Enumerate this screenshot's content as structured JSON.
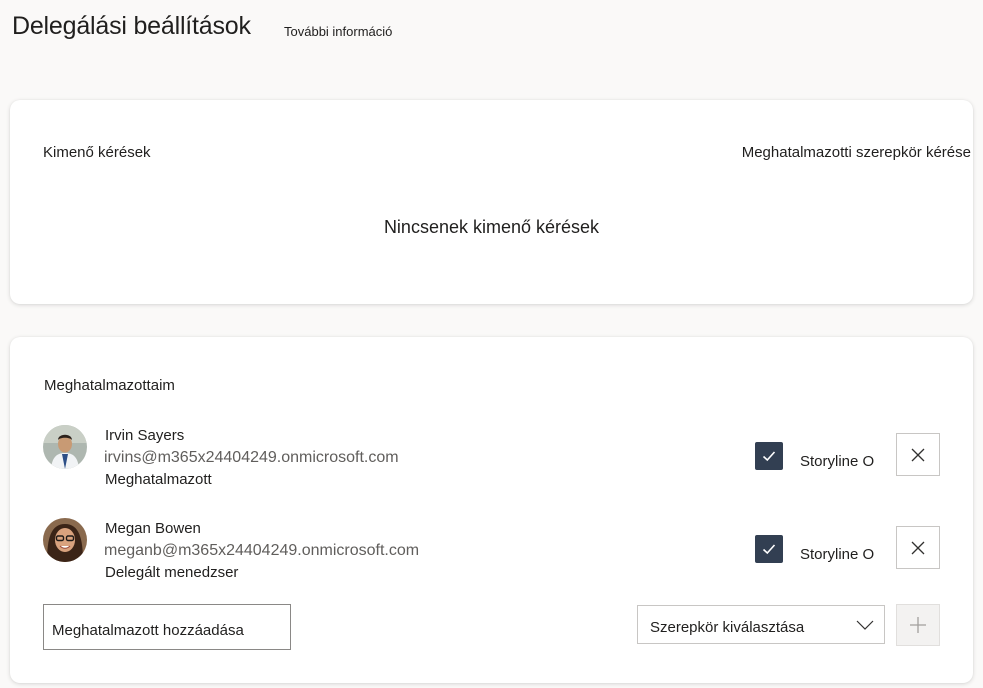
{
  "header": {
    "title": "Delegálási beállítások",
    "more_info": "További információ"
  },
  "outgoing": {
    "heading": "Kimenő kérések",
    "request_role": "Meghatalmazotti szerepkör kérése",
    "empty": "Nincsenek kimenő kérések"
  },
  "delegates": {
    "heading": "Meghatalmazottaim",
    "items": [
      {
        "name": "Irvin Sayers",
        "email": "irvins@m365x24404249.onmicrosoft.com",
        "role": "Meghatalmazott",
        "checkbox_label": "Storyline O",
        "checked": true
      },
      {
        "name": "Megan Bowen",
        "email": "meganb@m365x24404249.onmicrosoft.com",
        "role": "Delegált menedzser",
        "checkbox_label": "Storyline O",
        "checked": true
      }
    ],
    "add_input_value": "Meghatalmazott hozzáadása",
    "role_select_value": "Szerepkör kiválasztása"
  },
  "icons": {
    "check": "checkmark-icon",
    "remove": "close-icon",
    "chevron": "chevron-down-icon",
    "add": "plus-icon"
  },
  "colors": {
    "checkbox_fill": "#323f52",
    "background": "#faf9f8",
    "card": "#ffffff"
  }
}
